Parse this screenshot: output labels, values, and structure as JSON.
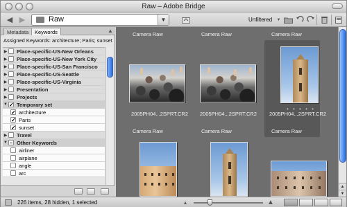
{
  "window": {
    "title": "Raw – Adobe Bridge"
  },
  "toolbar": {
    "path_label": "Raw",
    "filter_label": "Unfiltered"
  },
  "panel": {
    "tabs": [
      "Metadata",
      "Keywords"
    ],
    "active_tab": "Keywords",
    "assigned_keywords": "Assigned Keywords: architecture; Paris; sunset",
    "keywords": [
      {
        "label": "Place-specific-US-New Orleans",
        "checked": false,
        "level": "top"
      },
      {
        "label": "Place-specific-US-New York City",
        "checked": false,
        "level": "top"
      },
      {
        "label": "Place-specific-US-San Francisco",
        "checked": false,
        "level": "top"
      },
      {
        "label": "Place-specific-US-Seattle",
        "checked": false,
        "level": "top"
      },
      {
        "label": "Place-specific-US-Virginia",
        "checked": false,
        "level": "top"
      },
      {
        "label": "Presentation",
        "checked": false,
        "level": "top"
      },
      {
        "label": "Projects",
        "checked": false,
        "level": "top"
      },
      {
        "label": "Temporary set",
        "checked": true,
        "level": "top",
        "expanded": true
      },
      {
        "label": "architecture",
        "checked": true,
        "level": "child"
      },
      {
        "label": "Paris",
        "checked": true,
        "level": "child"
      },
      {
        "label": "sunset",
        "checked": true,
        "level": "child"
      },
      {
        "label": "Travel",
        "checked": false,
        "level": "top"
      },
      {
        "label": "Other Keywords",
        "checked": "dash",
        "level": "top",
        "expanded": true
      },
      {
        "label": "airliner",
        "checked": false,
        "level": "child"
      },
      {
        "label": "airplane",
        "checked": false,
        "level": "child"
      },
      {
        "label": "angle",
        "checked": false,
        "level": "child"
      },
      {
        "label": "arc",
        "checked": false,
        "level": "child"
      }
    ]
  },
  "content": {
    "row1_titles": [
      "Camera Raw",
      "Camera Raw",
      "Camera Raw"
    ],
    "row1_files": [
      "2005PH04...2SPRT.CR2",
      "2005PH04...2SPRT.CR2",
      "2005PH04...2SPRT.CR2"
    ],
    "row2_titles": [
      "Camera Raw",
      "Camera Raw",
      "Camera Raw"
    ],
    "dots": "• • • • •"
  },
  "status": {
    "text": "226 items, 28 hidden, 1 selected"
  },
  "icons": {
    "back": "back-arrow-icon",
    "forward": "forward-arrow-icon",
    "folder": "folder-icon",
    "new_folder": "new-folder-icon",
    "rotate_left": "rotate-left-icon",
    "rotate_right": "rotate-right-icon",
    "trash": "trash-icon"
  }
}
